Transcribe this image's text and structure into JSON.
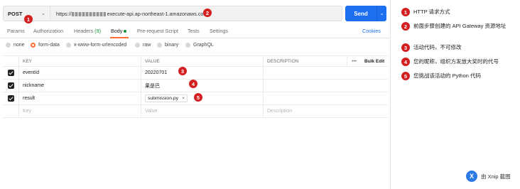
{
  "request": {
    "method": "POST",
    "url_masked_prefix": "https://",
    "url_suffix": "execute-api.ap-northeast-1.amazonaws.com",
    "send_label": "Send"
  },
  "tabs": [
    {
      "label": "Params"
    },
    {
      "label": "Authorization"
    },
    {
      "label": "Headers",
      "count": "(9)"
    },
    {
      "label": "Body"
    },
    {
      "label": "Pre-request Script"
    },
    {
      "label": "Tests"
    },
    {
      "label": "Settings"
    }
  ],
  "cookies_label": "Cookies",
  "body_types": [
    "none",
    "form-data",
    "x-www-form-urlencoded",
    "raw",
    "binary",
    "GraphQL"
  ],
  "table": {
    "headers": {
      "key": "KEY",
      "value": "VALUE",
      "description": "DESCRIPTION",
      "more": "•••",
      "bulk_edit": "Bulk Edit"
    },
    "rows": [
      {
        "key": "eventId",
        "value": "20220701"
      },
      {
        "key": "nickname",
        "value": "果是巴"
      },
      {
        "key": "result",
        "value": "submission.py",
        "remove": "×"
      }
    ],
    "placeholder": {
      "key": "Key",
      "value": "Value",
      "description": "Description"
    }
  },
  "callouts": [
    "1",
    "2",
    "3",
    "4",
    "5"
  ],
  "legend": [
    {
      "num": "1",
      "text": "HTTP 请求方式"
    },
    {
      "num": "2",
      "text": "前面步骤创建的 API Gateway 资源地址"
    },
    {
      "num": "3",
      "text": "活动代码，不可修改"
    },
    {
      "num": "4",
      "text": "您的昵称，组织方发放大奖时的代号"
    },
    {
      "num": "5",
      "text": "您挑战该活动的 Python 代码"
    }
  ],
  "watermark": {
    "logo": "X",
    "label": "由 Xnip 截图"
  },
  "colors": {
    "accent": "#ff6c37",
    "send": "#1e6ff0",
    "callout": "#d31f1f"
  }
}
